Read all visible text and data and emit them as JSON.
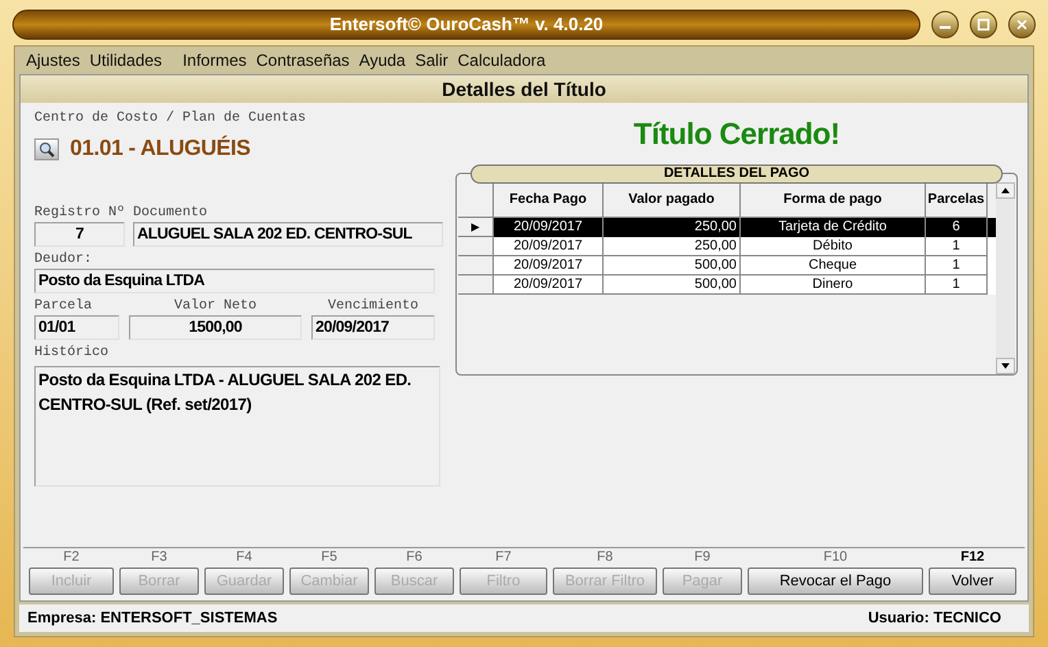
{
  "window": {
    "title": "Entersoft© OuroCash™ v. 4.0.20"
  },
  "menu": [
    {
      "label": "Ajustes"
    },
    {
      "label": "Utilidades"
    },
    {
      "label": "Informes"
    },
    {
      "label": "Contraseñas"
    },
    {
      "label": "Ayuda"
    },
    {
      "label": "Salir"
    },
    {
      "label": "Calculadora"
    }
  ],
  "section_title": "Detalles del Título",
  "cost_center": {
    "label": "Centro de Costo / Plan de Cuentas",
    "value": "01.01 - ALUGUÉIS"
  },
  "status_message": "Título Cerrado!",
  "fields": {
    "registro": {
      "label": "Registro Nº",
      "value": "7"
    },
    "documento": {
      "label": "Documento",
      "value": "ALUGUEL SALA 202 ED. CENTRO-SUL"
    },
    "deudor": {
      "label": "Deudor:",
      "value": "Posto da Esquina LTDA"
    },
    "parcela": {
      "label": "Parcela",
      "value": "01/01"
    },
    "valor_neto": {
      "label": "Valor Neto",
      "value": "1500,00"
    },
    "vencimiento": {
      "label": "Vencimiento",
      "value": "20/09/2017"
    },
    "historico": {
      "label": "Histórico",
      "value": "Posto da Esquina LTDA - ALUGUEL SALA 202 ED. CENTRO-SUL (Ref. set/2017)"
    }
  },
  "payments": {
    "title": "DETALLES DEL PAGO",
    "columns": [
      "Fecha Pago",
      "Valor pagado",
      "Forma de pago",
      "Parcelas"
    ],
    "rows": [
      {
        "cells": [
          "20/09/2017",
          "250,00",
          "Tarjeta de Crédito",
          "6"
        ],
        "selected": true,
        "indicator": "▶"
      },
      {
        "cells": [
          "20/09/2017",
          "250,00",
          "Débito",
          "1"
        ],
        "selected": false
      },
      {
        "cells": [
          "20/09/2017",
          "500,00",
          "Cheque",
          "1"
        ],
        "selected": false
      },
      {
        "cells": [
          "20/09/2017",
          "500,00",
          "Dinero",
          "1"
        ],
        "selected": false
      }
    ]
  },
  "buttons": [
    {
      "key": "F2",
      "label": "Incluir",
      "disabled": true,
      "key_bold": false
    },
    {
      "key": "F3",
      "label": "Borrar",
      "disabled": true,
      "key_bold": false
    },
    {
      "key": "F4",
      "label": "Guardar",
      "disabled": true,
      "key_bold": false
    },
    {
      "key": "F5",
      "label": "Cambiar",
      "disabled": true,
      "key_bold": false
    },
    {
      "key": "F6",
      "label": "Buscar",
      "disabled": true,
      "key_bold": false
    },
    {
      "key": "F7",
      "label": "Filtro",
      "disabled": true,
      "key_bold": false
    },
    {
      "key": "F8",
      "label": "Borrar Filtro",
      "disabled": true,
      "key_bold": false
    },
    {
      "key": "F9",
      "label": "Pagar",
      "disabled": true,
      "key_bold": false
    },
    {
      "key": "F10",
      "label": "Revocar el Pago",
      "disabled": false,
      "key_bold": false
    },
    {
      "key": "F12",
      "label": "Volver",
      "disabled": false,
      "key_bold": true
    }
  ],
  "status_bar": {
    "company": "Empresa: ENTERSOFT_SISTEMAS",
    "user": "Usuario: TECNICO"
  }
}
